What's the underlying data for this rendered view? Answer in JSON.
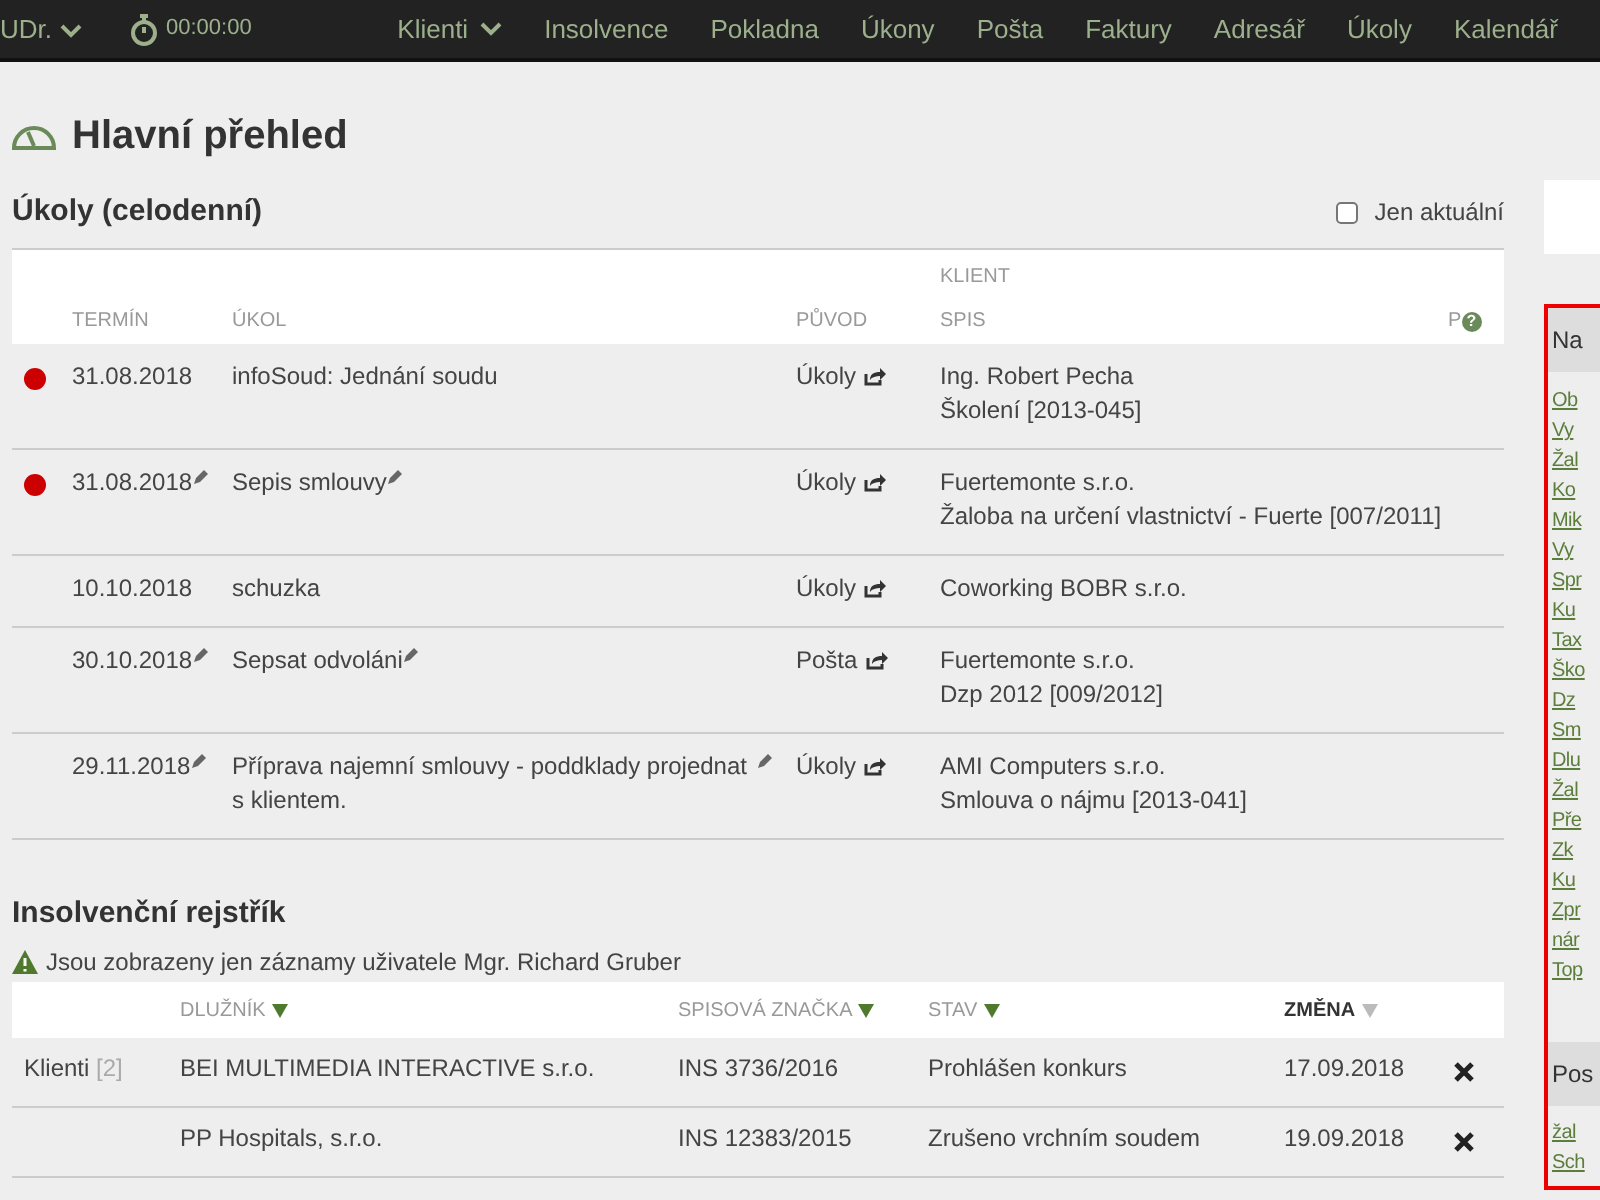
{
  "top_bar": {
    "user": "UDr.",
    "timer": "00:00:00",
    "nav": [
      {
        "label": "Klienti",
        "dropdown": true
      },
      {
        "label": "Insolvence",
        "dropdown": false
      },
      {
        "label": "Pokladna",
        "dropdown": false
      },
      {
        "label": "Úkony",
        "dropdown": false
      },
      {
        "label": "Pošta",
        "dropdown": false
      },
      {
        "label": "Faktury",
        "dropdown": false
      },
      {
        "label": "Adresář",
        "dropdown": false
      },
      {
        "label": "Úkoly",
        "dropdown": false
      },
      {
        "label": "Kalendář",
        "dropdown": false
      }
    ]
  },
  "page_title": "Hlavní přehled",
  "tasks": {
    "title": "Úkoly (celodenní)",
    "filter": {
      "label": "Jen aktuální",
      "checked": false
    },
    "columns": {
      "deadline": "TERMÍN",
      "task": "ÚKOL",
      "origin": "PŮVOD",
      "client": "KLIENT",
      "file": "SPIS",
      "last": "P",
      "help": "?"
    },
    "rows": [
      {
        "overdue": true,
        "date": "31.08.2018",
        "date_edited": false,
        "task": "infoSoud: Jednání soudu",
        "task_edited": false,
        "origin": "Úkoly",
        "client": "Ing. Robert Pecha",
        "file": "Školení [2013-045]"
      },
      {
        "overdue": true,
        "date": "31.08.2018",
        "date_edited": true,
        "task": "Sepis smlouvy",
        "task_edited": true,
        "origin": "Úkoly",
        "client": "Fuertemonte s.r.o.",
        "file": "Žaloba na určení vlastnictví - Fuerte [007/2011]"
      },
      {
        "overdue": false,
        "date": "10.10.2018",
        "date_edited": false,
        "task": "schuzka",
        "task_edited": false,
        "origin": "Úkoly",
        "client": "Coworking BOBR s.r.o."
      },
      {
        "overdue": false,
        "date": "30.10.2018",
        "date_edited": true,
        "task": "Sepsat odvoláni",
        "task_edited": true,
        "origin": "Pošta",
        "client": "Fuertemonte s.r.o.",
        "file": "Dzp 2012 [009/2012]"
      },
      {
        "overdue": false,
        "date": "29.11.2018",
        "date_edited": true,
        "task": "Příprava najemní smlouvy - poddklady projednat s klientem.",
        "task_edited": true,
        "origin": "Úkoly",
        "client": "AMI Computers s.r.o.",
        "file": "Smlouva o nájmu [2013-041]"
      }
    ]
  },
  "insolvency": {
    "title": "Insolvenční rejstřík",
    "notice": "Jsou zobrazeny jen záznamy uživatele Mgr. Richard Gruber",
    "columns": [
      {
        "label": "DLUŽNÍK",
        "selected": false
      },
      {
        "label": "SPISOVÁ ZNAČKA",
        "selected": false
      },
      {
        "label": "STAV",
        "selected": false
      },
      {
        "label": "ZMĚNA",
        "selected": true
      }
    ],
    "rows": [
      {
        "group": "Klienti",
        "count": "[2]",
        "debtor": "BEI MULTIMEDIA INTERACTIVE s.r.o.",
        "case": "INS 3736/2016",
        "state": "Prohlášen konkurs",
        "changed": "17.09.2018"
      },
      {
        "debtor": "PP Hospitals, s.r.o.",
        "case": "INS 12383/2015",
        "state": "Zrušeno vrchním soudem",
        "changed": "19.09.2018"
      }
    ]
  },
  "side_panel": {
    "sections": [
      {
        "title": "Na",
        "links": [
          "Ob",
          "Vy",
          "Žal",
          "Ko",
          "Mik",
          "Vy",
          "Spr",
          "Ku",
          "Tax",
          "Ško",
          "Dz",
          "Sm",
          "Dlu",
          "Žal",
          "Pře",
          "Zk",
          "Ku",
          "Zpr",
          "nár",
          "Top"
        ]
      },
      {
        "title": "Pos",
        "links": [
          "žal",
          "Sch"
        ]
      }
    ]
  }
}
